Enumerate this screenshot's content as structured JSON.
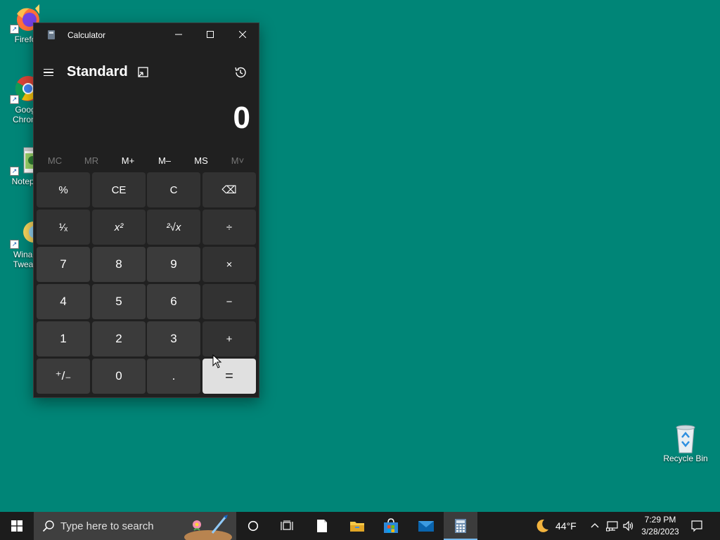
{
  "desktop": {
    "icons": [
      {
        "label": "Firefo"
      },
      {
        "label": "Goog\nChrom"
      },
      {
        "label": "Notepa"
      },
      {
        "label": "Winae\nTweak"
      },
      {
        "label": "Recycle Bin"
      }
    ]
  },
  "calculator": {
    "title": "Calculator",
    "mode": "Standard",
    "display": "0",
    "memory": [
      "MC",
      "MR",
      "M+",
      "M–",
      "MS",
      "M˅"
    ],
    "keys": [
      [
        "%",
        "CE",
        "C",
        "⌫"
      ],
      [
        "¹⁄ₓ",
        "x²",
        "²√x",
        "÷"
      ],
      [
        "7",
        "8",
        "9",
        "×"
      ],
      [
        "4",
        "5",
        "6",
        "−"
      ],
      [
        "1",
        "2",
        "3",
        "+"
      ],
      [
        "⁺/₋",
        "0",
        ".",
        "="
      ]
    ]
  },
  "taskbar": {
    "search_placeholder": "Type here to search",
    "weather_temp": "44°F",
    "time": "7:29 PM",
    "date": "3/28/2023"
  }
}
